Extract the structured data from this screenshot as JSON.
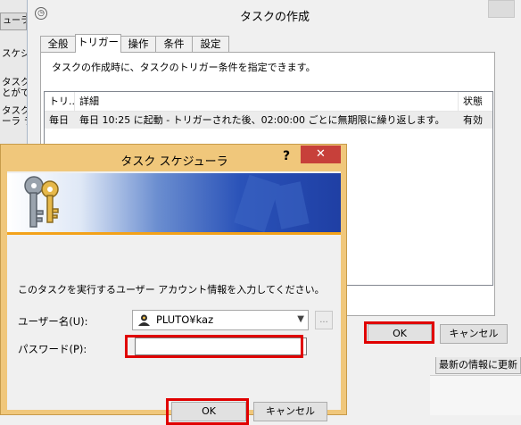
{
  "background_window": {
    "tab_label": "ューラ(",
    "sidebar_text": [
      "スケジ",
      "タスク",
      "とがで",
      "タスク",
      "ーラ ラ"
    ],
    "refresh_button": "最新の情報に更新"
  },
  "create_task": {
    "title": "タスクの作成",
    "tabs": [
      "全般",
      "トリガー",
      "操作",
      "条件",
      "設定"
    ],
    "active_tab": "トリガー",
    "description": "タスクの作成時に、タスクのトリガー条件を指定できます。",
    "columns": [
      "トリ...",
      "詳細",
      "状態"
    ],
    "rows": [
      {
        "trigger": "毎日",
        "detail": "毎日 10:25 に起動 - トリガーされた後、02:00:00 ごとに無期限に繰り返します。",
        "status": "有効"
      }
    ],
    "ok_label": "OK",
    "cancel_label": "キャンセル"
  },
  "credentials_dialog": {
    "title": "タスク スケジューラ",
    "help_label": "?",
    "close_label": "✕",
    "message": "このタスクを実行するユーザー アカウント情報を入力してください。",
    "user_label": "ユーザー名(U):",
    "user_value": "PLUTO¥kaz",
    "browse_label": "...",
    "password_label": "パスワード(P):",
    "password_value": "",
    "ok_label": "OK",
    "cancel_label": "キャンセル"
  },
  "colors": {
    "highlight": "#e00000",
    "dialog_frame": "#f0c77b",
    "close_button": "#c7403a",
    "banner_blue": "#2a52b8",
    "banner_orange": "#f3a21a"
  },
  "icons": [
    "clock-icon",
    "keys-icon",
    "user-icon",
    "chevron-down-icon"
  ]
}
